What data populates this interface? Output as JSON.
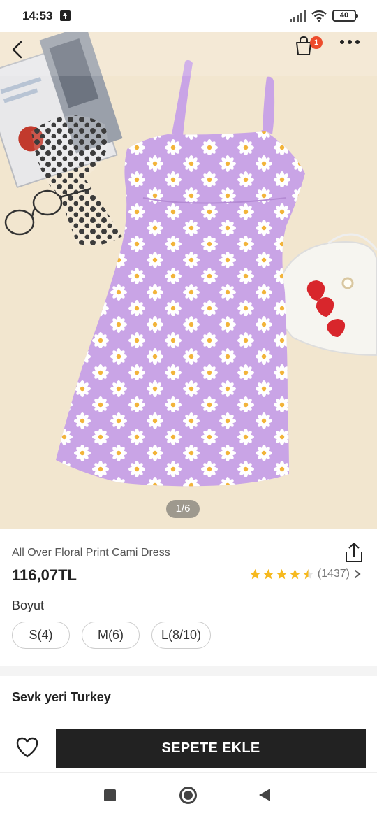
{
  "status_bar": {
    "time": "14:53",
    "battery": "40"
  },
  "header": {
    "cart_badge": "1",
    "image_indicator": "1/6"
  },
  "product": {
    "title": "All Over Floral Print Cami Dress",
    "price": "116,07TL",
    "rating_value": 4.5,
    "rating_count": "(1437)",
    "size_label": "Boyut",
    "sizes": [
      "S(4)",
      "M(6)",
      "L(8/10)"
    ]
  },
  "shipping": {
    "text": "Sevk yeri Turkey"
  },
  "bottom_bar": {
    "add_to_cart": "SEPETE EKLE"
  },
  "colors": {
    "accent_badge": "#ed4c2c",
    "star": "#f6b91f",
    "cta_bg": "#222222",
    "dress": "#c9a4e6"
  },
  "icons": {
    "back": "chevron-left-icon",
    "cart": "shopping-bag-icon",
    "more": "more-horizontal-icon",
    "share": "share-icon",
    "wishlist": "heart-icon"
  }
}
